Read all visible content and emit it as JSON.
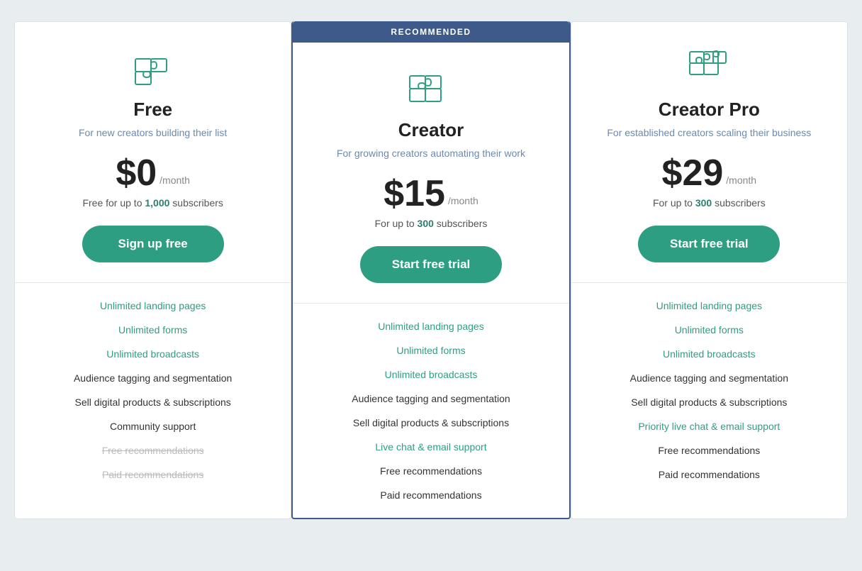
{
  "plans": [
    {
      "id": "free",
      "recommended": false,
      "name": "Free",
      "description": "For new creators building their list",
      "price": "$0",
      "period": "/month",
      "subscribers_text": "Free for up to ",
      "subscribers_bold": "1,000",
      "subscribers_suffix": " subscribers",
      "button_label": "Sign up free",
      "features": [
        {
          "text": "Unlimited landing pages",
          "style": "teal"
        },
        {
          "text": "Unlimited forms",
          "style": "teal"
        },
        {
          "text": "Unlimited broadcasts",
          "style": "teal"
        },
        {
          "text": "Audience tagging and segmentation",
          "style": "normal"
        },
        {
          "text": "Sell digital products & subscriptions",
          "style": "normal"
        },
        {
          "text": "Community support",
          "style": "normal"
        },
        {
          "text": "Free recommendations",
          "style": "strikethrough"
        },
        {
          "text": "Paid recommendations",
          "style": "strikethrough"
        }
      ]
    },
    {
      "id": "creator",
      "recommended": true,
      "recommended_label": "RECOMMENDED",
      "name": "Creator",
      "description": "For growing creators automating their work",
      "price": "$15",
      "period": "/month",
      "subscribers_text": "For up to ",
      "subscribers_bold": "300",
      "subscribers_suffix": " subscribers",
      "button_label": "Start free trial",
      "features": [
        {
          "text": "Unlimited landing pages",
          "style": "teal"
        },
        {
          "text": "Unlimited forms",
          "style": "teal"
        },
        {
          "text": "Unlimited broadcasts",
          "style": "teal"
        },
        {
          "text": "Audience tagging and segmentation",
          "style": "normal"
        },
        {
          "text": "Sell digital products & subscriptions",
          "style": "normal"
        },
        {
          "text": "Live chat & email support",
          "style": "teal"
        },
        {
          "text": "Free recommendations",
          "style": "normal"
        },
        {
          "text": "Paid recommendations",
          "style": "normal"
        }
      ]
    },
    {
      "id": "creator-pro",
      "recommended": false,
      "name": "Creator Pro",
      "description": "For established creators scaling their business",
      "price": "$29",
      "period": "/month",
      "subscribers_text": "For up to ",
      "subscribers_bold": "300",
      "subscribers_suffix": " subscribers",
      "button_label": "Start free trial",
      "features": [
        {
          "text": "Unlimited landing pages",
          "style": "teal"
        },
        {
          "text": "Unlimited forms",
          "style": "teal"
        },
        {
          "text": "Unlimited broadcasts",
          "style": "teal"
        },
        {
          "text": "Audience tagging and segmentation",
          "style": "normal"
        },
        {
          "text": "Sell digital products & subscriptions",
          "style": "normal"
        },
        {
          "text": "Priority live chat & email support",
          "style": "teal"
        },
        {
          "text": "Free recommendations",
          "style": "normal"
        },
        {
          "text": "Paid recommendations",
          "style": "normal"
        }
      ]
    }
  ]
}
